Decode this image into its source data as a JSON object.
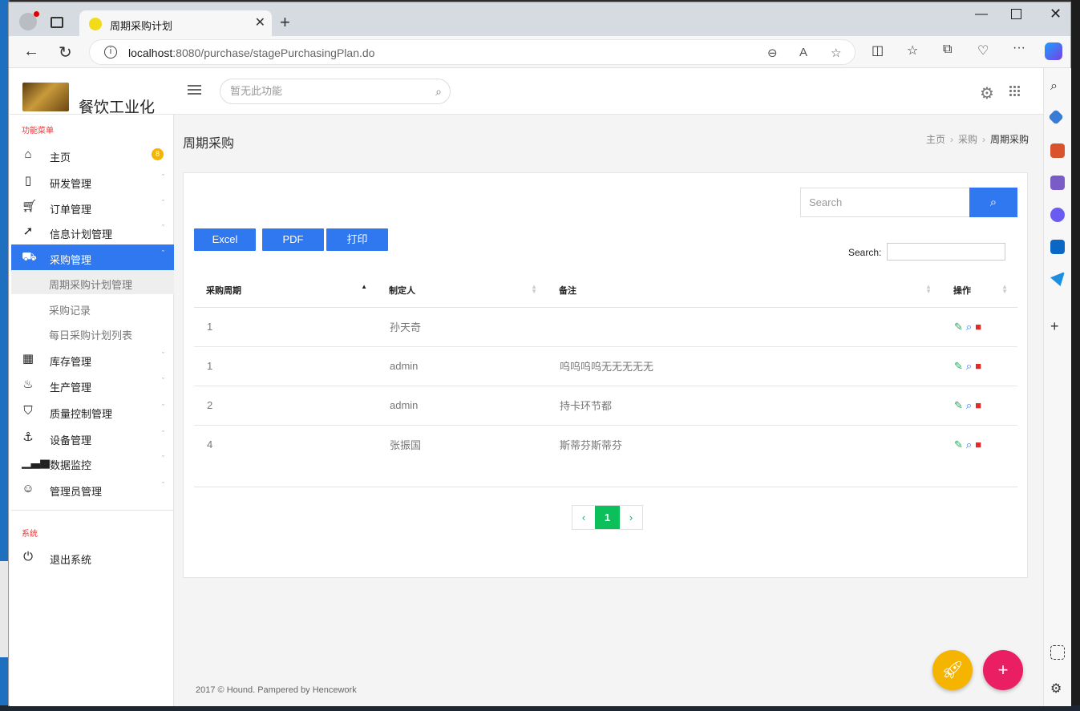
{
  "browser": {
    "tab_title": "周期采购计划",
    "url_host": "localhost",
    "url_rest": ":8080/purchase/stagePurchasingPlan.do"
  },
  "app": {
    "brand": "餐饮工业化",
    "top_search_placeholder": "暂无此功能"
  },
  "sidebar": {
    "section_menu": "功能菜单",
    "section_system": "系统",
    "home_label": "主页",
    "home_badge": "8",
    "items": [
      {
        "label": "研发管理",
        "icon": "book-icon"
      },
      {
        "label": "订单管理",
        "icon": "cart-icon"
      },
      {
        "label": "信息计划管理",
        "icon": "paper-plane-icon"
      },
      {
        "label": "采购管理",
        "icon": "truck-icon"
      },
      {
        "label": "库存管理",
        "icon": "grid-icon"
      },
      {
        "label": "生产管理",
        "icon": "fire-icon"
      },
      {
        "label": "质量控制管理",
        "icon": "html5-icon"
      },
      {
        "label": "设备管理",
        "icon": "anchor-icon"
      },
      {
        "label": "数据监控",
        "icon": "signal-icon"
      },
      {
        "label": "管理员管理",
        "icon": "user-icon"
      }
    ],
    "subitems": [
      "周期采购计划管理",
      "采购记录",
      "每日采购计划列表"
    ],
    "logout_label": "退出系统"
  },
  "page": {
    "title": "周期采购",
    "breadcrumb": [
      "主页",
      "采购",
      "周期采购"
    ]
  },
  "card": {
    "search_placeholder": "Search",
    "buttons": [
      "Excel",
      "PDF",
      "打印"
    ],
    "table_search_label": "Search:"
  },
  "table": {
    "headers": [
      "采购周期",
      "制定人",
      "备注",
      "操作"
    ],
    "rows": [
      {
        "period": "1",
        "maker": "孙天奇",
        "note": ""
      },
      {
        "period": "1",
        "maker": "admin",
        "note": "呜呜呜呜无无无无无"
      },
      {
        "period": "2",
        "maker": "admin",
        "note": "持卡环节都"
      },
      {
        "period": "4",
        "maker": "张振国",
        "note": "斯蒂芬斯蒂芬"
      }
    ]
  },
  "pagination": {
    "prev": "‹",
    "page": "1",
    "next": "›"
  },
  "footer": "2017 © Hound. Pampered by Hencework",
  "colors": {
    "accent": "#2f78ef",
    "badge": "#f4b400",
    "fab_yellow": "#f4b400",
    "fab_pink": "#e91e63",
    "pager_active": "#0bbf5a"
  }
}
